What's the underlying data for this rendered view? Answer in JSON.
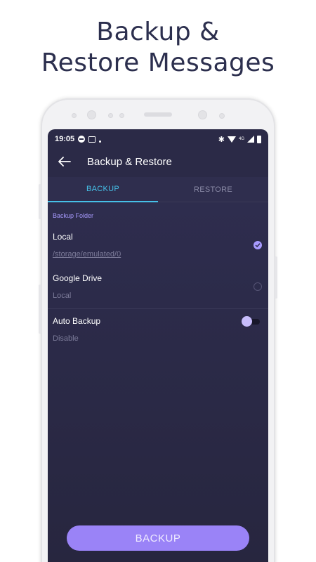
{
  "promo": {
    "line1": "Backup &",
    "line2": "Restore Messages"
  },
  "status_bar": {
    "time": "19:05",
    "network": "4G"
  },
  "app_bar": {
    "title": "Backup & Restore",
    "back_icon": "arrow-left-icon"
  },
  "tabs": [
    {
      "label": "BACKUP",
      "active": true
    },
    {
      "label": "RESTORE",
      "active": false
    }
  ],
  "backup": {
    "section_label": "Backup Folder",
    "options": [
      {
        "name": "Local",
        "path": "/storage/emulated/0",
        "selected": true
      },
      {
        "name": "Google Drive",
        "path": "Local",
        "selected": false
      }
    ],
    "auto_backup": {
      "name": "Auto Backup",
      "status": "Disable",
      "enabled": false
    },
    "button_label": "BACKUP"
  },
  "colors": {
    "background": "#2b2a47",
    "accent": "#a89bff",
    "tab_active": "#46c0e8",
    "button": "#9a83f7"
  }
}
